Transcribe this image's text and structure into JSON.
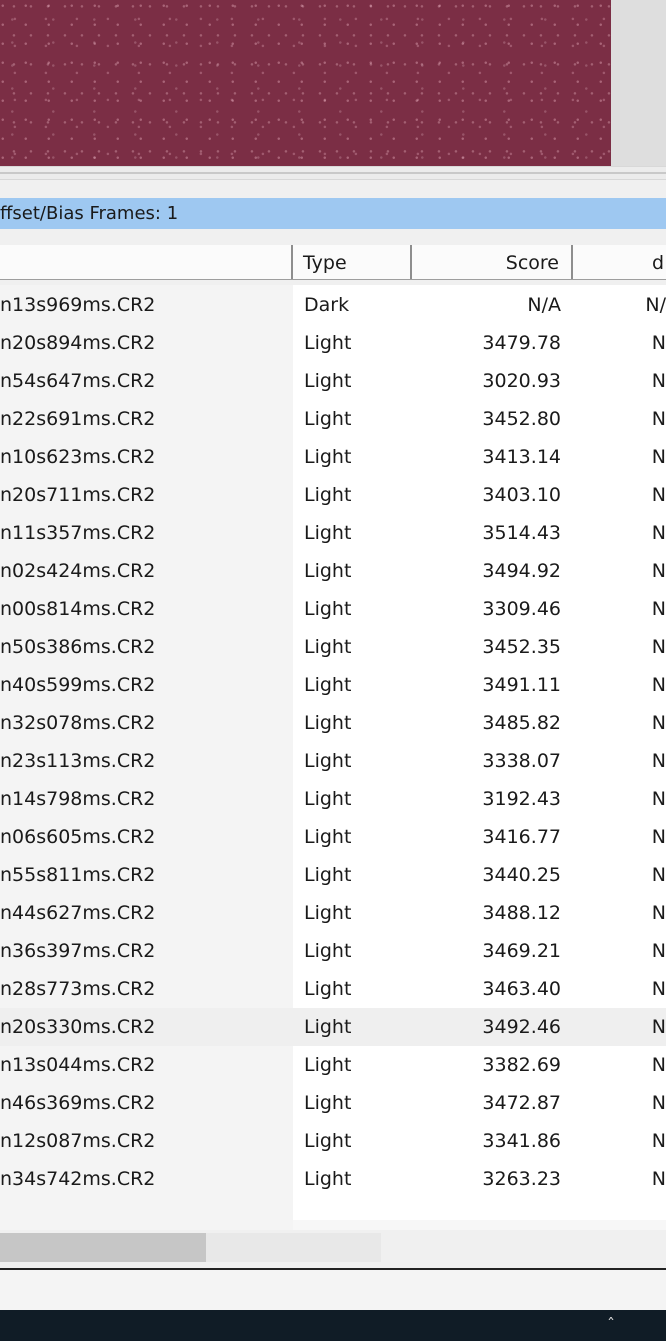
{
  "group": {
    "label": "ffset/Bias Frames: 1"
  },
  "columns": {
    "file": "",
    "type": "Type",
    "score": "Score",
    "d": "d"
  },
  "rows": [
    {
      "file": "n13s969ms.CR2",
      "type": "Dark",
      "score": "N/A",
      "d": "N/"
    },
    {
      "file": "n20s894ms.CR2",
      "type": "Light",
      "score": "3479.78",
      "d": "N"
    },
    {
      "file": "n54s647ms.CR2",
      "type": "Light",
      "score": "3020.93",
      "d": "N"
    },
    {
      "file": "n22s691ms.CR2",
      "type": "Light",
      "score": "3452.80",
      "d": "N"
    },
    {
      "file": "n10s623ms.CR2",
      "type": "Light",
      "score": "3413.14",
      "d": "N"
    },
    {
      "file": "n20s711ms.CR2",
      "type": "Light",
      "score": "3403.10",
      "d": "N"
    },
    {
      "file": "n11s357ms.CR2",
      "type": "Light",
      "score": "3514.43",
      "d": "N"
    },
    {
      "file": "n02s424ms.CR2",
      "type": "Light",
      "score": "3494.92",
      "d": "N"
    },
    {
      "file": "n00s814ms.CR2",
      "type": "Light",
      "score": "3309.46",
      "d": "N"
    },
    {
      "file": "n50s386ms.CR2",
      "type": "Light",
      "score": "3452.35",
      "d": "N"
    },
    {
      "file": "n40s599ms.CR2",
      "type": "Light",
      "score": "3491.11",
      "d": "N"
    },
    {
      "file": "n32s078ms.CR2",
      "type": "Light",
      "score": "3485.82",
      "d": "N"
    },
    {
      "file": "n23s113ms.CR2",
      "type": "Light",
      "score": "3338.07",
      "d": "N"
    },
    {
      "file": "n14s798ms.CR2",
      "type": "Light",
      "score": "3192.43",
      "d": "N"
    },
    {
      "file": "n06s605ms.CR2",
      "type": "Light",
      "score": "3416.77",
      "d": "N"
    },
    {
      "file": "n55s811ms.CR2",
      "type": "Light",
      "score": "3440.25",
      "d": "N"
    },
    {
      "file": "n44s627ms.CR2",
      "type": "Light",
      "score": "3488.12",
      "d": "N"
    },
    {
      "file": "n36s397ms.CR2",
      "type": "Light",
      "score": "3469.21",
      "d": "N"
    },
    {
      "file": "n28s773ms.CR2",
      "type": "Light",
      "score": "3463.40",
      "d": "N"
    },
    {
      "file": "n20s330ms.CR2",
      "type": "Light",
      "score": "3492.46",
      "d": "N",
      "highlighted": true
    },
    {
      "file": "n13s044ms.CR2",
      "type": "Light",
      "score": "3382.69",
      "d": "N"
    },
    {
      "file": "n46s369ms.CR2",
      "type": "Light",
      "score": "3472.87",
      "d": "N"
    },
    {
      "file": "n12s087ms.CR2",
      "type": "Light",
      "score": "3341.86",
      "d": "N"
    },
    {
      "file": "n34s742ms.CR2",
      "type": "Light",
      "score": "3263.23",
      "d": "N"
    }
  ]
}
